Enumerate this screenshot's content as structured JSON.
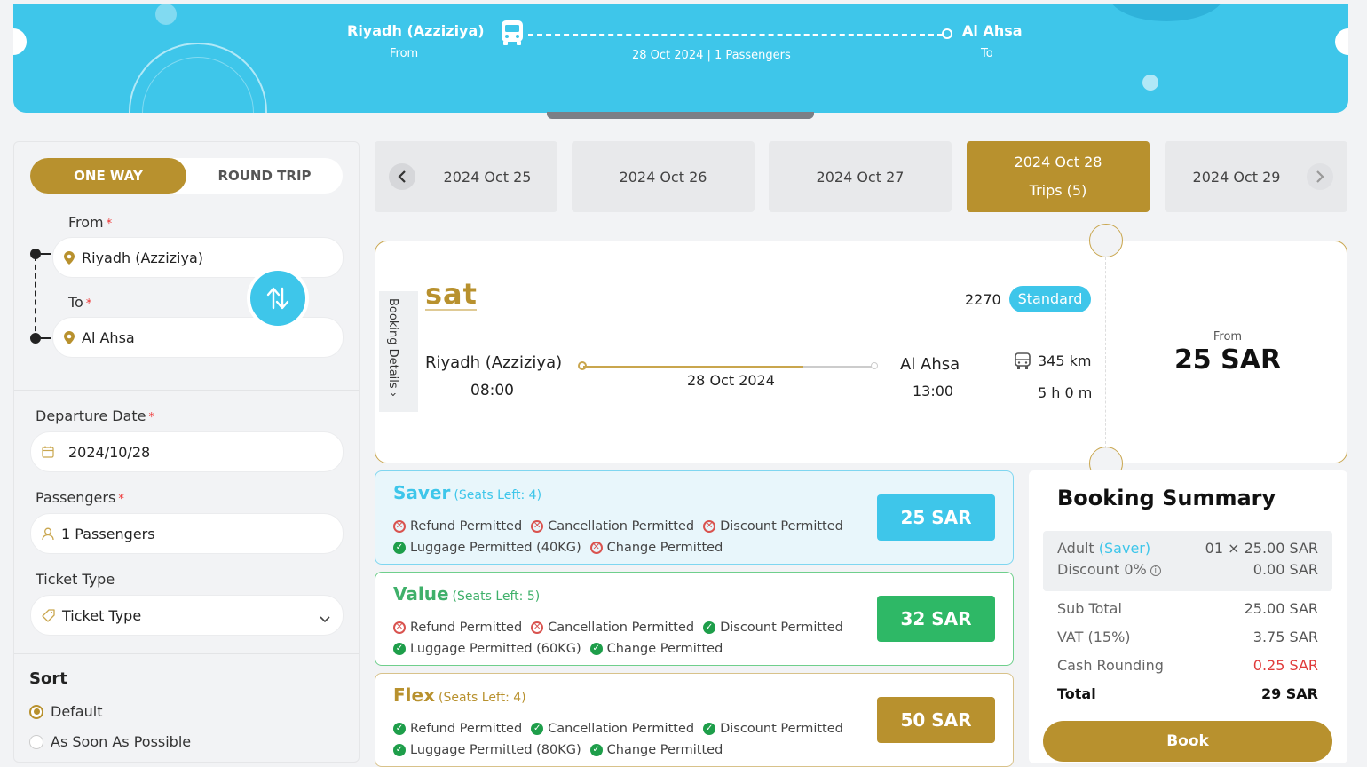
{
  "banner": {
    "from_city": "Riyadh (Azziziya)",
    "from_label": "From",
    "to_city": "Al Ahsa",
    "to_label": "To",
    "trip_info": "28 Oct 2024 | 1 Passengers"
  },
  "search": {
    "trip_type": {
      "one_way": "ONE WAY",
      "round_trip": "ROUND TRIP",
      "selected": "one_way"
    },
    "from_label": "From",
    "from_value": "Riyadh (Azziziya)",
    "to_label": "To",
    "to_value": "Al Ahsa",
    "required_mark": "*",
    "departure_label": "Departure Date",
    "departure_value": "2024/10/28",
    "passengers_label": "Passengers",
    "passengers_value": "1 Passengers",
    "ticket_type_label": "Ticket Type",
    "ticket_type_value": "Ticket Type"
  },
  "sort": {
    "title": "Sort",
    "options": [
      "Default",
      "As Soon As Possible"
    ],
    "selected": "Default"
  },
  "date_tabs": [
    {
      "label": "2024 Oct 25"
    },
    {
      "label": "2024 Oct 26"
    },
    {
      "label": "2024 Oct 27"
    },
    {
      "label": "2024 Oct 28",
      "sub": "Trips (5)",
      "active": true
    },
    {
      "label": "2024 Oct 29"
    }
  ],
  "trip": {
    "booking_details": "Booking Details",
    "operator": "sat",
    "trip_number": "2270",
    "class_badge": "Standard",
    "from_city": "Riyadh (Azziziya)",
    "depart_time": "08:00",
    "date": "28 Oct 2024",
    "to_city": "Al Ahsa",
    "arrive_time": "13:00",
    "distance": "345 km",
    "duration": "5 h 0 m",
    "from_label": "From",
    "from_price": "25 SAR"
  },
  "fares": [
    {
      "name": "Saver",
      "seats": "(Seats Left: 4)",
      "price": "25 SAR",
      "row1": [
        {
          "text": "Refund Permitted",
          "ok": false
        },
        {
          "text": "Cancellation Permitted",
          "ok": false
        },
        {
          "text": "Discount Permitted",
          "ok": false
        }
      ],
      "row2": [
        {
          "text": "Luggage Permitted (40KG)",
          "ok": true
        },
        {
          "text": "Change Permitted",
          "ok": false
        }
      ]
    },
    {
      "name": "Value",
      "seats": "(Seats Left: 5)",
      "price": "32 SAR",
      "row1": [
        {
          "text": "Refund Permitted",
          "ok": false
        },
        {
          "text": "Cancellation Permitted",
          "ok": false
        },
        {
          "text": "Discount Permitted",
          "ok": true
        }
      ],
      "row2": [
        {
          "text": "Luggage Permitted (60KG)",
          "ok": true
        },
        {
          "text": "Change Permitted",
          "ok": true
        }
      ]
    },
    {
      "name": "Flex",
      "seats": "(Seats Left: 4)",
      "price": "50 SAR",
      "row1": [
        {
          "text": "Refund Permitted",
          "ok": true
        },
        {
          "text": "Cancellation Permitted",
          "ok": true
        },
        {
          "text": "Discount Permitted",
          "ok": true
        }
      ],
      "row2": [
        {
          "text": "Luggage Permitted (80KG)",
          "ok": true
        },
        {
          "text": "Change Permitted",
          "ok": true
        }
      ]
    }
  ],
  "summary": {
    "title": "Booking Summary",
    "adult_label": "Adult",
    "adult_fare": "(Saver)",
    "adult_value": "01 × 25.00 SAR",
    "discount_label": "Discount 0%",
    "discount_value": "0.00 SAR",
    "subtotal_label": "Sub Total",
    "subtotal_value": "25.00 SAR",
    "vat_label": "VAT (15%)",
    "vat_value": "3.75 SAR",
    "rounding_label": "Cash Rounding",
    "rounding_value": "0.25 SAR",
    "total_label": "Total",
    "total_value": "29 SAR",
    "book_label": "Book"
  },
  "colors": {
    "primary_blue": "#3ec6ea",
    "gold": "#b8912e",
    "green": "#2eb866",
    "red": "#d9534f"
  }
}
